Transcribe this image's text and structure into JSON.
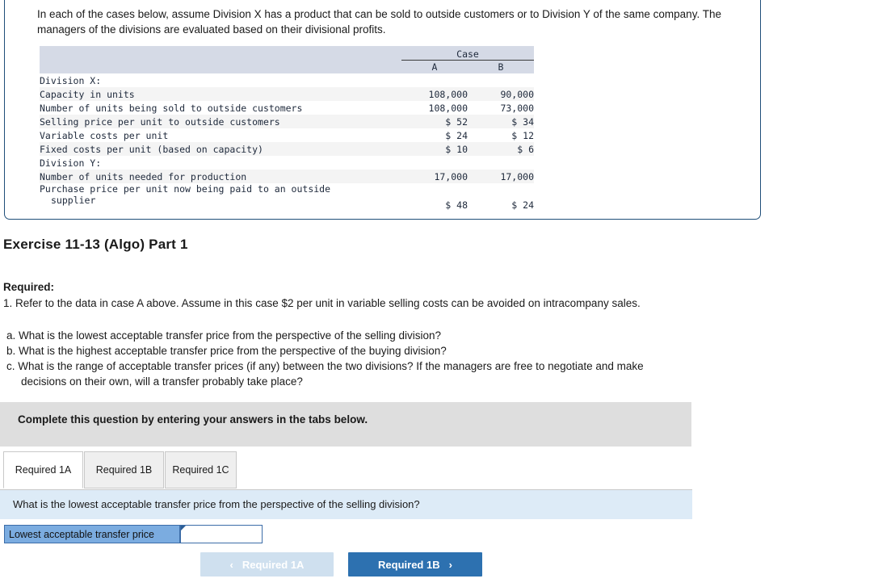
{
  "problem": {
    "intro": "In each of the cases below, assume Division X has a product that can be sold to outside customers or to Division Y of the same company. The managers of the divisions are evaluated based on their divisional profits.",
    "table": {
      "group_header": "Case",
      "columns": [
        "A",
        "B"
      ],
      "rows": [
        {
          "label": "Division X:",
          "indent": 0,
          "values": [
            "",
            ""
          ],
          "shaded": false
        },
        {
          "label": "Capacity in units",
          "indent": 1,
          "values": [
            "108,000",
            "90,000"
          ],
          "shaded": true
        },
        {
          "label": "Number of units being sold to outside customers",
          "indent": 1,
          "values": [
            "108,000",
            "73,000"
          ],
          "shaded": false
        },
        {
          "label": "Selling price per unit to outside customers",
          "indent": 1,
          "values": [
            "$ 52",
            "$ 34"
          ],
          "shaded": true
        },
        {
          "label": "Variable costs per unit",
          "indent": 1,
          "values": [
            "$ 24",
            "$ 12"
          ],
          "shaded": false
        },
        {
          "label": "Fixed costs per unit (based on capacity)",
          "indent": 1,
          "values": [
            "$ 10",
            "$ 6"
          ],
          "shaded": true
        },
        {
          "label": "Division Y:",
          "indent": 0,
          "values": [
            "",
            ""
          ],
          "shaded": false
        },
        {
          "label": "Number of units needed for production",
          "indent": 1,
          "values": [
            "17,000",
            "17,000"
          ],
          "shaded": true
        },
        {
          "label": "Purchase price per unit now being paid to an outside",
          "label_line2": "supplier",
          "indent": 1,
          "values": [
            "$ 48",
            "$ 24"
          ],
          "shaded": false,
          "twoline": true
        }
      ]
    }
  },
  "exercise": {
    "title": "Exercise 11-13 (Algo) Part 1"
  },
  "required": {
    "label": "Required:",
    "item_1": "1. Refer to the data in case A above. Assume in this case $2 per unit in variable selling costs can be avoided on intracompany sales.",
    "sub_questions": [
      {
        "text": "a. What is the lowest acceptable transfer price from the perspective of the selling division?",
        "continuation": ""
      },
      {
        "text": "b. What is the highest acceptable transfer price from the perspective of the buying division?",
        "continuation": ""
      },
      {
        "text": "c. What is the range of acceptable transfer prices (if any) between the two divisions? If the managers are free to negotiate and make",
        "continuation": "decisions on their own, will a transfer probably take place?"
      }
    ]
  },
  "answer_area": {
    "banner_text": "Complete this question by entering your answers in the tabs below.",
    "tabs": [
      {
        "label": "Required 1A",
        "active": true
      },
      {
        "label": "Required 1B",
        "active": false
      },
      {
        "label": "Required 1C",
        "active": false
      }
    ],
    "question_prompt": "What is the lowest acceptable transfer price from the perspective of the selling division?",
    "answer_label": "Lowest acceptable transfer price",
    "answer_value": "",
    "answer_placeholder": "",
    "nav": {
      "prev_label": "Required 1A",
      "prev_chevron": "‹",
      "next_label": "Required 1B",
      "next_chevron": "›"
    }
  },
  "colors": {
    "card_border": "#1f4e79",
    "table_header_band": "#d5dae6",
    "table_row_shade": "#f4f4f4",
    "banner_gray": "#dedede",
    "question_blue": "#ddebf7",
    "answer_label_blue": "#7bace0",
    "next_button_blue": "#2d71b0",
    "prev_button_blue": "#cfe0ef"
  }
}
